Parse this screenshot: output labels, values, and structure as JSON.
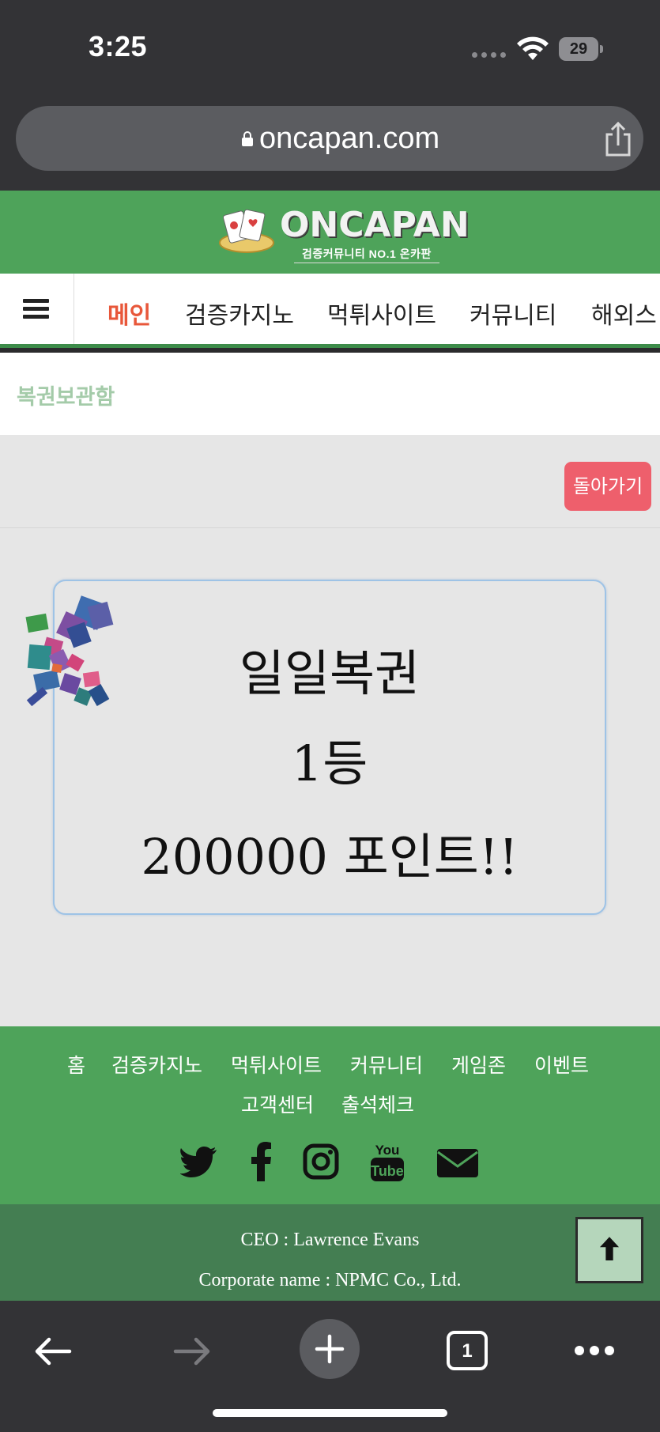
{
  "status_bar": {
    "time": "3:25",
    "battery": "29"
  },
  "browser": {
    "url": "oncapan.com",
    "tabs_count": "1"
  },
  "site": {
    "logo_name": "ONCAPAN",
    "logo_sub": "검증커뮤니티 NO.1 온카판"
  },
  "nav": {
    "items": [
      {
        "label": "메인",
        "active": true
      },
      {
        "label": "검증카지노"
      },
      {
        "label": "먹튀사이트"
      },
      {
        "label": "커뮤니티"
      },
      {
        "label": "해외스"
      }
    ]
  },
  "breadcrumb": "복권보관함",
  "back_button": "돌아가기",
  "lottery": {
    "line1": "일일복권",
    "line2": "1등",
    "line3": "200000 포인트!!"
  },
  "footer": {
    "links": [
      "홈",
      "검증카지노",
      "먹튀사이트",
      "커뮤니티",
      "게임존",
      "이벤트",
      "고객센터",
      "출석체크"
    ],
    "social": [
      "twitter-icon",
      "facebook-icon",
      "instagram-icon",
      "youtube-icon",
      "mail-icon"
    ],
    "ceo": "CEO : Lawrence Evans",
    "corp": "Corporate name : NPMC Co., Ltd."
  },
  "colors": {
    "brand_green": "#4ea35a",
    "active_nav": "#e8573a",
    "back_button": "#ee5f6c"
  }
}
